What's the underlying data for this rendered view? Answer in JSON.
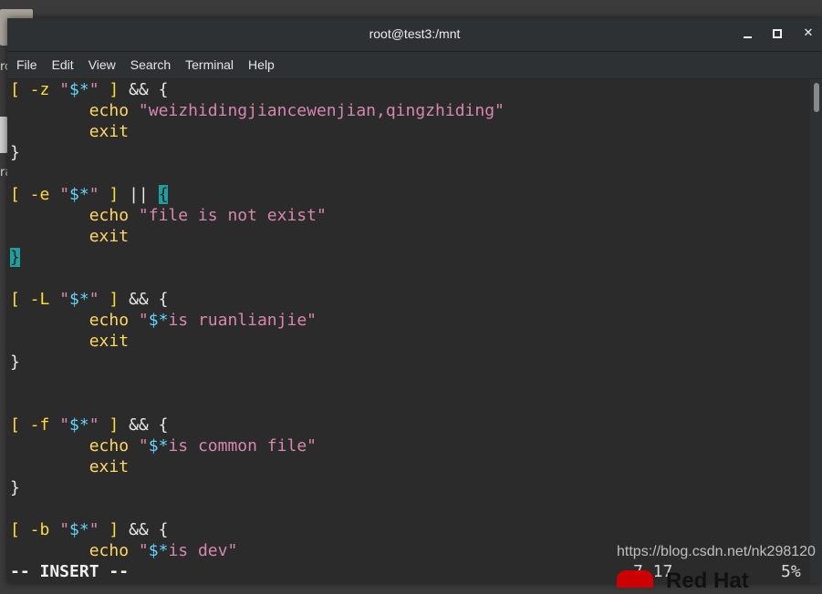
{
  "desktop": {
    "label_1": "ro",
    "label_2": "ra",
    "brand_text": "Red Hat"
  },
  "window": {
    "title": "root@test3:/mnt",
    "controls": [
      "minimize-icon",
      "maximize-icon",
      "close-icon"
    ]
  },
  "menu": [
    "File",
    "Edit",
    "View",
    "Search",
    "Terminal",
    "Help"
  ],
  "code": {
    "l1": {
      "a": "[ -z ",
      "q1": "\"",
      "v": "$*",
      "q2": "\"",
      "b": " ] ",
      "op": "&& {"
    },
    "l2": {
      "kw": "echo",
      "str": "\"weizhidingjiancewenjian,qingzhiding\""
    },
    "l3": {
      "kw": "exit"
    },
    "l4": {
      "t": "}"
    },
    "l6": {
      "a": "[ -e ",
      "q1": "\"",
      "v": "$*",
      "q2": "\"",
      "b": " ] ",
      "op": "|| ",
      "brace": "{"
    },
    "l7": {
      "kw": "echo",
      "str": "\"file is not exist\""
    },
    "l8": {
      "kw": "exit"
    },
    "l9": {
      "t": "}"
    },
    "l11": {
      "a": "[ -L ",
      "q1": "\"",
      "v": "$*",
      "q2": "\"",
      "b": " ] ",
      "op": "&& {"
    },
    "l12": {
      "kw": "echo",
      "q": "\"",
      "v": "$*",
      "str": "is ruanlianjie\""
    },
    "l13": {
      "kw": "exit"
    },
    "l14": {
      "t": "}"
    },
    "l17": {
      "a": "[ -f ",
      "q1": "\"",
      "v": "$*",
      "q2": "\"",
      "b": " ] ",
      "op": "&& {"
    },
    "l18": {
      "kw": "echo",
      "q": "\"",
      "v": "$*",
      "str": "is common file\""
    },
    "l19": {
      "kw": "exit"
    },
    "l20": {
      "t": "}"
    },
    "l22": {
      "a": "[ -b ",
      "q1": "\"",
      "v": "$*",
      "q2": "\"",
      "b": " ] ",
      "op": "&& {"
    },
    "l23": {
      "kw": "echo",
      "q": "\"",
      "v": "$*",
      "str": "is dev\""
    }
  },
  "status": {
    "mode": "-- INSERT --",
    "position": "7,17",
    "percent": "5%"
  },
  "watermark": "https://blog.csdn.net/nk298120",
  "colors": {
    "keyword": "#ffd75f",
    "variable": "#5fd7ff",
    "string": "#d787af",
    "match_highlight": "#1fa0a0",
    "background": "#2b2b2b"
  }
}
